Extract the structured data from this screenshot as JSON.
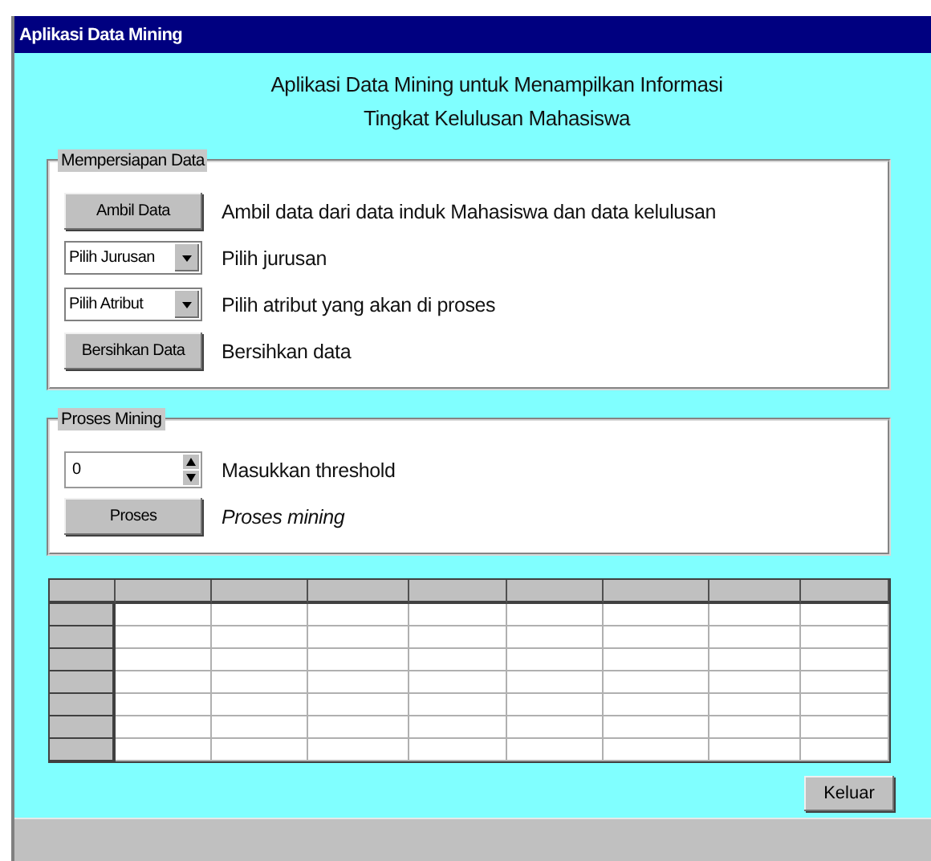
{
  "window": {
    "title": "Aplikasi Data Mining"
  },
  "heading": [
    "Aplikasi Data Mining untuk Menampilkan Informasi",
    "Tingkat Kelulusan Mahasiswa"
  ],
  "groups": [
    {
      "title": "Mempersiapan Data",
      "rows": [
        {
          "kind": "button",
          "control": "Ambil Data",
          "description": "Ambil data dari data induk Mahasiswa dan data kelulusan",
          "italic": false
        },
        {
          "kind": "dropdown",
          "control": "Pilih Jurusan",
          "description": "Pilih jurusan",
          "italic": false
        },
        {
          "kind": "dropdown",
          "control": "Pilih Atribut",
          "description": "Pilih atribut yang akan di proses",
          "italic": false
        },
        {
          "kind": "button",
          "control": "Bersihkan Data",
          "description": "Bersihkan data",
          "italic": false
        }
      ]
    },
    {
      "title": "Proses Mining",
      "rows": [
        {
          "kind": "spinner",
          "control": "0",
          "description": "Masukkan threshold",
          "italic": false
        },
        {
          "kind": "button",
          "control": "Proses",
          "description": "Proses mining",
          "italic": true
        }
      ]
    }
  ],
  "buttons": [
    "Keluar"
  ]
}
